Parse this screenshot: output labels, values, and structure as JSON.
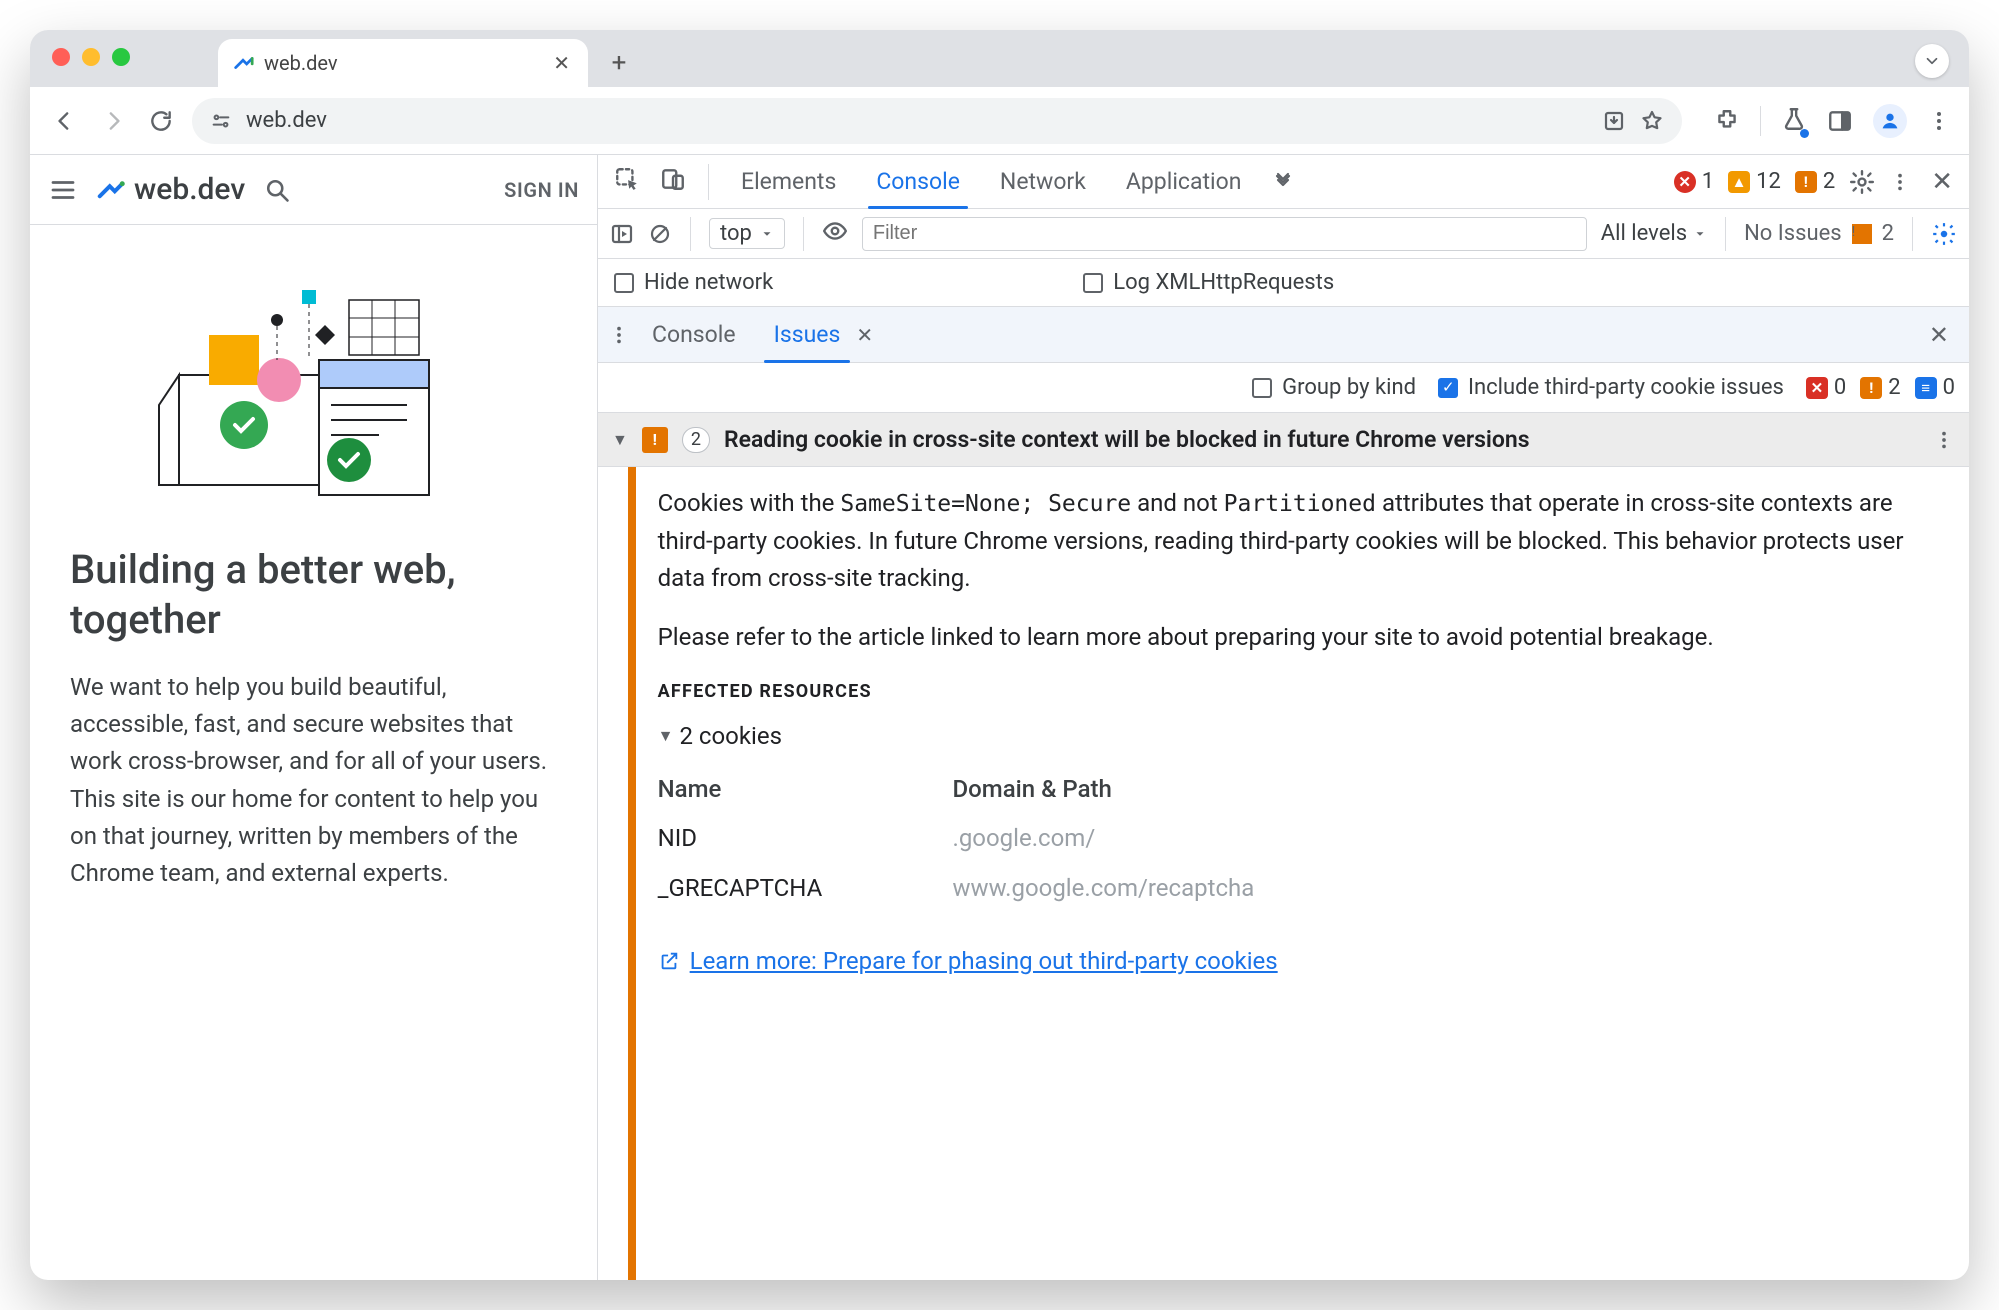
{
  "browser": {
    "tab_title": "web.dev",
    "url": "web.dev",
    "new_tab_tooltip": "+"
  },
  "page": {
    "brand": "web.dev",
    "signin": "SIGN IN",
    "hero_title": "Building a better web, together",
    "hero_body": "We want to help you build beautiful, accessible, fast, and secure websites that work cross-browser, and for all of your users. This site is our home for content to help you on that journey, written by members of the Chrome team, and external experts."
  },
  "devtools": {
    "panels": [
      "Elements",
      "Console",
      "Network",
      "Application"
    ],
    "active_panel": "Console",
    "status": {
      "errors": 1,
      "warnings": 12,
      "issues": 2
    },
    "console_toolbar": {
      "context": "top",
      "filter_placeholder": "Filter",
      "levels_label": "All levels",
      "no_issues_label": "No Issues",
      "sidebar_issues": 2
    },
    "checks": {
      "hide_network": "Hide network",
      "log_xhr": "Log XMLHttpRequests"
    },
    "drawer": {
      "tabs": [
        "Console",
        "Issues"
      ],
      "active": "Issues"
    },
    "issues_filter": {
      "group_by_kind": "Group by kind",
      "include_third_party": "Include third-party cookie issues",
      "counts": {
        "error": 0,
        "warn": 2,
        "info": 0
      }
    },
    "issue": {
      "count": 2,
      "title": "Reading cookie in cross-site context will be blocked in future Chrome versions",
      "para1_pre": "Cookies with the ",
      "code1": "SameSite=None; Secure",
      "para1_mid": " and not ",
      "code2": "Partitioned",
      "para1_post": " attributes that operate in cross-site contexts are third-party cookies. In future Chrome versions, reading third-party cookies will be blocked. This behavior protects user data from cross-site tracking.",
      "para2": "Please refer to the article linked to learn more about preparing your site to avoid potential breakage.",
      "affected_heading": "AFFECTED RESOURCES",
      "cookies_label": "2 cookies",
      "table": {
        "col1": "Name",
        "col2": "Domain & Path",
        "rows": [
          {
            "name": "NID",
            "domain": ".google.com/"
          },
          {
            "name": "_GRECAPTCHA",
            "domain": "www.google.com/recaptcha"
          }
        ]
      },
      "learn_more": "Learn more: Prepare for phasing out third-party cookies"
    }
  }
}
